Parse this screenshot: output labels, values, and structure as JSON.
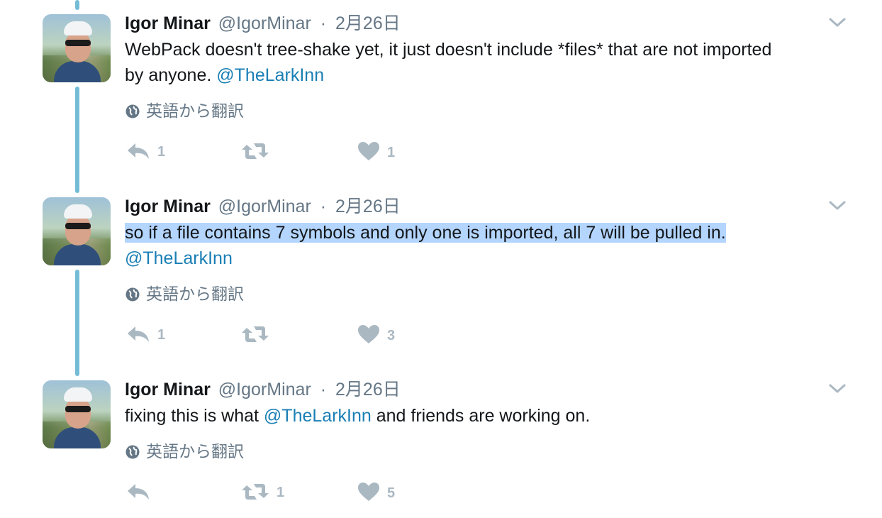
{
  "tweets": [
    {
      "name": "Igor Minar",
      "handle": "@IgorMinar",
      "separator": "·",
      "date": "2月26日",
      "text_parts": [
        "WebPack doesn't tree-shake yet, it just doesn't include *files* that are not imported by anyone. ",
        "@TheLarkInn"
      ],
      "translate_label": "英語から翻訳",
      "reply_count": "1",
      "retweet_count": "",
      "like_count": "1"
    },
    {
      "name": "Igor Minar",
      "handle": "@IgorMinar",
      "separator": "·",
      "date": "2月26日",
      "text_parts": [
        "so if a file contains 7 symbols and only one is imported, all 7 will be pulled in.",
        "@TheLarkInn"
      ],
      "translate_label": "英語から翻訳",
      "reply_count": "1",
      "retweet_count": "",
      "like_count": "3"
    },
    {
      "name": "Igor Minar",
      "handle": "@IgorMinar",
      "separator": "·",
      "date": "2月26日",
      "text_parts": [
        "fixing this is what ",
        "@TheLarkInn",
        " and friends are working on."
      ],
      "translate_label": "英語から翻訳",
      "reply_count": "",
      "retweet_count": "1",
      "like_count": "5"
    }
  ],
  "icons": {
    "reply": "reply-icon",
    "retweet": "retweet-icon",
    "like": "heart-icon",
    "globe": "globe-icon",
    "more": "chevron-down-icon"
  },
  "colors": {
    "thread_line": "#74bcd6",
    "mention": "#1a7fb5",
    "muted": "#657786",
    "action": "#aab8c2",
    "selection": "#b4d5fe"
  }
}
